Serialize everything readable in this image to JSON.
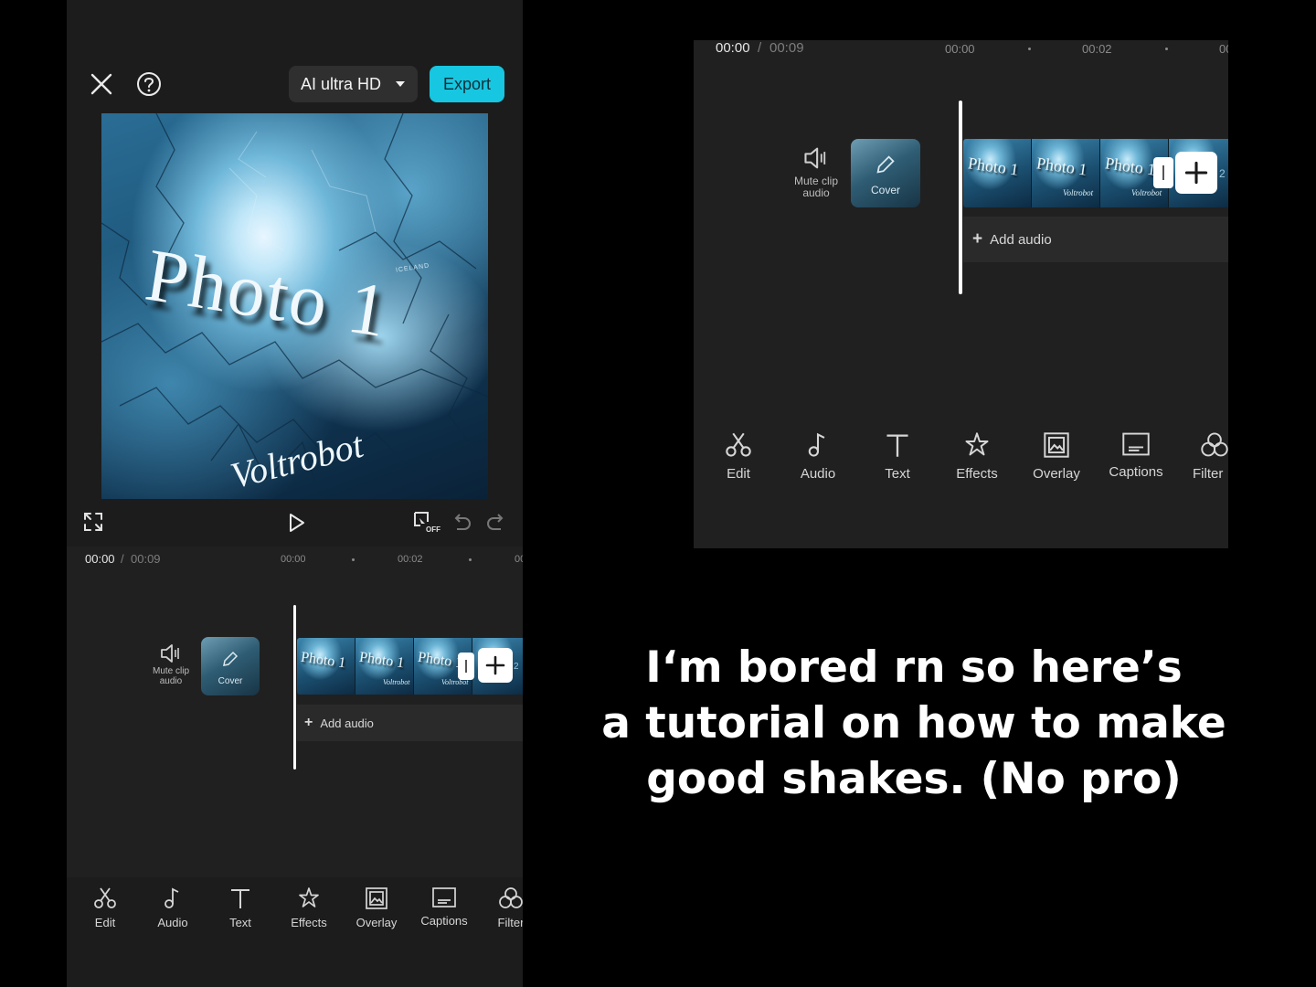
{
  "editor": {
    "quality_label": "AI ultra HD",
    "export_label": "Export",
    "preview": {
      "title": "Photo 1",
      "signature": "Voltrobot",
      "map_text": "ICELAND"
    },
    "keyframe_badge": "OFF",
    "timeline": {
      "current_time": "00:00",
      "separator": "/",
      "total_time": "00:09",
      "ruler": [
        "00:00",
        "00:02",
        "00"
      ],
      "mute_label_line1": "Mute clip",
      "mute_label_line2": "audio",
      "cover_label": "Cover",
      "frame_label": "Photo 1",
      "frame_signature": "Voltrobot",
      "next_clip_number": "2",
      "add_audio_label": "Add audio"
    },
    "toolbar": [
      "Edit",
      "Audio",
      "Text",
      "Effects",
      "Overlay",
      "Captions",
      "Filter"
    ]
  },
  "zoom_toolbar_last": "Filter",
  "caption": {
    "line1": "I‘m bored rn so here’s",
    "line2": "a tutorial on how to make",
    "line3": "good shakes. (No pro)"
  },
  "colors": {
    "accent": "#17c6e0",
    "panel": "#1c1c1c",
    "timeline": "#202020"
  }
}
